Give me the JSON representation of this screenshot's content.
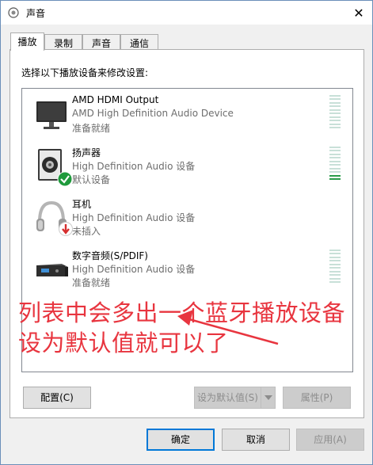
{
  "window": {
    "title": "声音",
    "close_glyph": "✕"
  },
  "tabs": [
    {
      "label": "播放",
      "active": true
    },
    {
      "label": "录制",
      "active": false
    },
    {
      "label": "声音",
      "active": false
    },
    {
      "label": "通信",
      "active": false
    }
  ],
  "panel": {
    "instruction": "选择以下播放设备来修改设置:"
  },
  "devices": [
    {
      "name": "AMD HDMI Output",
      "description": "AMD High Definition Audio Device",
      "status": "准备就绪",
      "icon": "monitor-icon",
      "level": 0
    },
    {
      "name": "扬声器",
      "description": "High Definition Audio 设备",
      "status": "默认设备",
      "icon": "speaker-icon",
      "level": 0.15,
      "badge": "default-check-icon"
    },
    {
      "name": "耳机",
      "description": "High Definition Audio 设备",
      "status": "未插入",
      "icon": "headphones-icon",
      "level": 0,
      "badge": "unplugged-arrow-icon"
    },
    {
      "name": "数字音频(S/PDIF)",
      "description": "High Definition Audio 设备",
      "status": "准备就绪",
      "icon": "digital-audio-icon",
      "level": 0
    }
  ],
  "annotation": {
    "line1": "列表中会多出一个蓝牙播放设备",
    "line2": "设为默认值就可以了",
    "color": "#e8353f"
  },
  "panel_buttons": {
    "configure": "配置(C)",
    "set_default": "设为默认值(S)",
    "properties": "属性(P)"
  },
  "dialog_buttons": {
    "ok": "确定",
    "cancel": "取消",
    "apply": "应用(A)"
  },
  "colors": {
    "accent": "#0078d7",
    "meter_active": "#2a9c4a",
    "check_badge": "#1f9a3c",
    "unplugged_badge": "#d62d2d"
  }
}
